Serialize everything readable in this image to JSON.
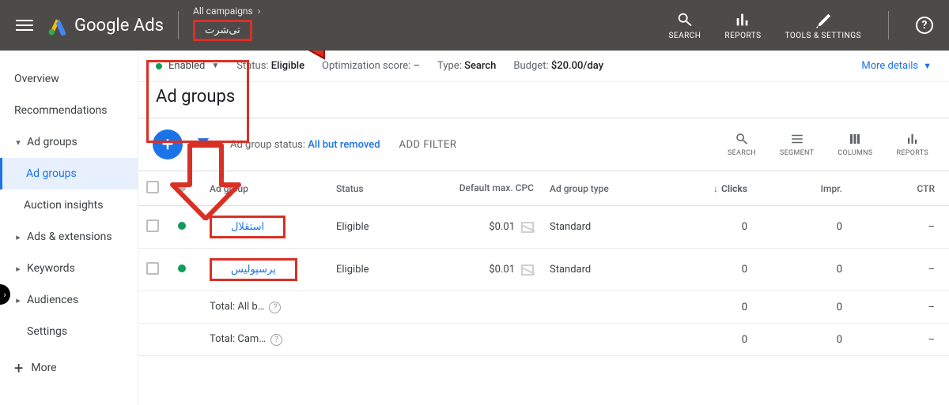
{
  "header": {
    "product": "Google Ads",
    "breadcrumb_top": "All campaigns",
    "campaign_name": "تی‌شرت",
    "actions": {
      "search": "SEARCH",
      "reports": "REPORTS",
      "tools": "TOOLS & SETTINGS"
    }
  },
  "sidebar": {
    "items": [
      "Overview",
      "Recommendations",
      "Ad groups",
      "Ad groups",
      "Auction insights",
      "Ads & extensions",
      "Keywords",
      "Audiences",
      "Settings"
    ],
    "more": "More"
  },
  "status": {
    "enabled": "Enabled",
    "status_label": "Status:",
    "status_value": "Eligible",
    "opt_label": "Optimization score:",
    "opt_value": "–",
    "type_label": "Type:",
    "type_value": "Search",
    "budget_label": "Budget:",
    "budget_value": "$20.00/day",
    "more": "More details"
  },
  "page_title": "Ad groups",
  "toolbar": {
    "filter_label": "Ad group status:",
    "filter_value": "All but removed",
    "add_filter": "ADD FILTER",
    "minis": [
      "SEARCH",
      "SEGMENT",
      "COLUMNS",
      "REPORTS"
    ]
  },
  "table": {
    "headers": {
      "adgroup": "Ad group",
      "status": "Status",
      "cpc": "Default max. CPC",
      "type": "Ad group type",
      "clicks": "Clicks",
      "impr": "Impr.",
      "ctr": "CTR"
    },
    "rows": [
      {
        "name": "استقلال",
        "status": "Eligible",
        "cpc": "$0.01",
        "type": "Standard",
        "clicks": "0",
        "impr": "0",
        "ctr": "–"
      },
      {
        "name": "پرسپولیس",
        "status": "Eligible",
        "cpc": "$0.01",
        "type": "Standard",
        "clicks": "0",
        "impr": "0",
        "ctr": "–"
      }
    ],
    "totals": [
      {
        "label": "Total: All b…",
        "clicks": "0",
        "impr": "0",
        "ctr": "–"
      },
      {
        "label": "Total: Cam…",
        "clicks": "0",
        "impr": "0",
        "ctr": "–"
      }
    ]
  }
}
